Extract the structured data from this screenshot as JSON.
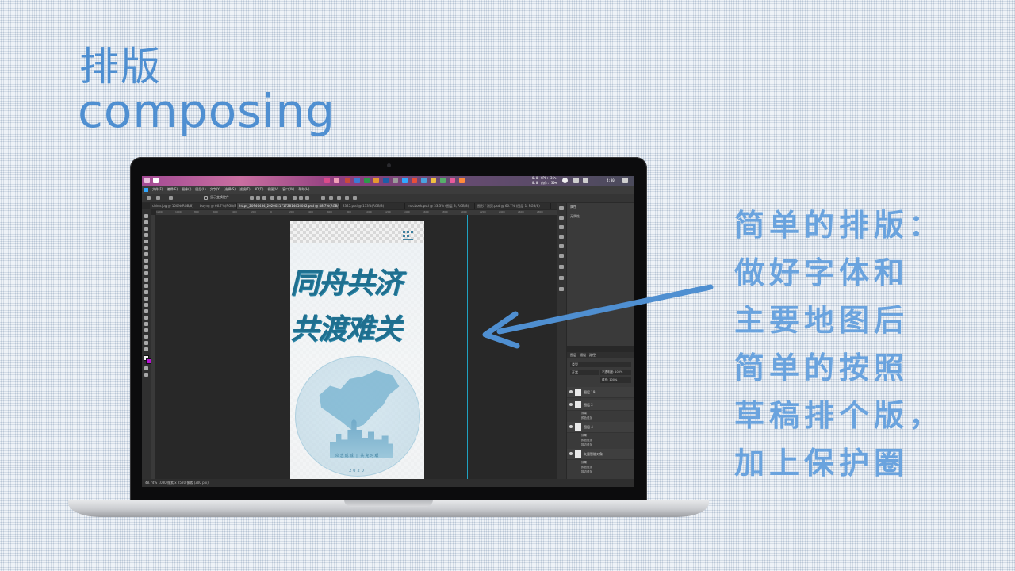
{
  "slide": {
    "title_cn": "排版",
    "title_en": "composing"
  },
  "annotation": {
    "lines": [
      "简单的排版：",
      "做好字体和",
      "主要地图后",
      "简单的按照",
      "草稿排个版，",
      "加上保护圈"
    ],
    "color": "#6aa3de"
  },
  "photoshop": {
    "menu": [
      "文件(F)",
      "编辑(E)",
      "图像(I)",
      "图层(L)",
      "文字(Y)",
      "选择(S)",
      "滤镜(T)",
      "3D(D)",
      "视图(V)",
      "窗口(W)",
      "帮助(H)"
    ],
    "tabs": [
      {
        "label": "china.jpg @ 100%(RGB/8)",
        "active": false
      },
      {
        "label": "buyng @ 66.7%(RGB/8)",
        "active": false
      },
      {
        "label": "https_20946484_20200217172814454082.psd @ 48.7%(RGB/8) *",
        "active": true
      },
      {
        "label": "2325.psd @ 133%(RGB/8)",
        "active": false
      },
      {
        "label": "macbook.psd @ 33.3% (图层 3, RGB/8)",
        "active": false
      },
      {
        "label": "图形 / 测页.psd @ 66.7% (图层 1, RGB/8)",
        "active": false
      }
    ],
    "ruler_ticks": [
      "1200",
      "1000",
      "800",
      "600",
      "400",
      "200",
      "0",
      "200",
      "400",
      "600",
      "800",
      "1000",
      "1200",
      "1400",
      "1600",
      "1800",
      "2000",
      "2200",
      "2400",
      "2600",
      "2800"
    ],
    "options_label": "显示变换控件",
    "poster": {
      "line1": "同舟共济",
      "line2": "共渡难关",
      "slogan": "众志成城 | 共克时艰",
      "year": "2020",
      "colors": {
        "accent": "#1f6f8f",
        "bubble": "#bcdcea"
      }
    },
    "properties": {
      "title": "属性",
      "subtitle": "无属性"
    },
    "layers": {
      "tabs": [
        "图层",
        "通道",
        "路径"
      ],
      "kind_label": "类型",
      "blend_label": "正常",
      "opacity_label": "不透明度: 100%",
      "fill_label": "填充: 100%",
      "rows": [
        {
          "name": "图层 19",
          "subs": []
        },
        {
          "name": "图层 2",
          "subs": [
            "效果",
            "颜色叠加"
          ]
        },
        {
          "name": "图层 4",
          "subs": [
            "效果",
            "颜色叠加",
            "描边叠加"
          ]
        },
        {
          "name": "矢量智能对象",
          "subs": [
            "效果",
            "颜色叠加",
            "描边叠加"
          ]
        }
      ]
    },
    "status": "48.74%   1080 像素 x 2520 像素 (300 ppi)",
    "taskbar": {
      "net_up": "0.0",
      "net_down": "0.0",
      "cpu": "CPU: 36%",
      "mem": "内存: 30%",
      "clock": "4:30"
    }
  }
}
